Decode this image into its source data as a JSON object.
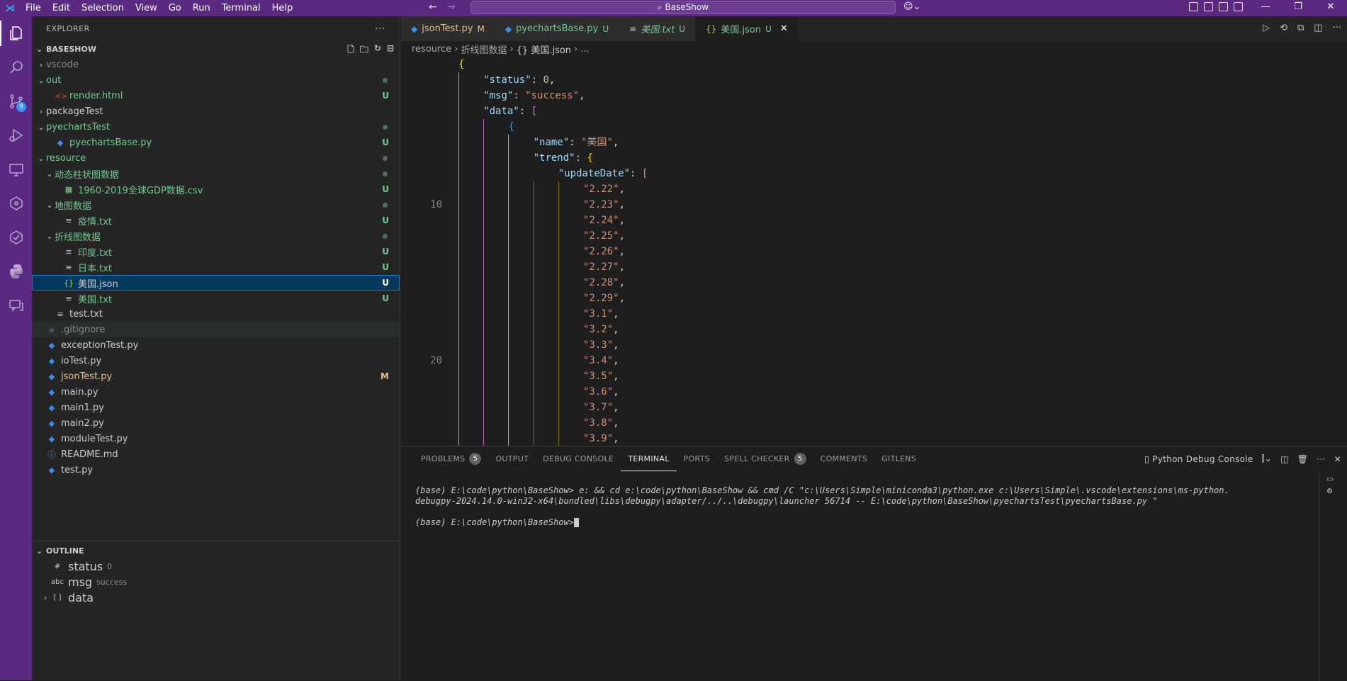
{
  "titlebar": {
    "menu": [
      "File",
      "Edit",
      "Selection",
      "View",
      "Go",
      "Run",
      "Terminal",
      "Help"
    ],
    "search": "BaseShow"
  },
  "activity": {
    "scm_badge": "9"
  },
  "sidebar": {
    "header": "EXPLORER",
    "more": "···",
    "root": "BASESHOW",
    "tree": [
      {
        "label": "vscode",
        "depth": 0,
        "chev": "›",
        "icon": "",
        "color": "gray",
        "status": "",
        "dot": false
      },
      {
        "label": "out",
        "depth": 0,
        "chev": "⌄",
        "icon": "",
        "color": "green",
        "status": "",
        "dot": true
      },
      {
        "label": "render.html",
        "depth": 1,
        "chev": "",
        "icon": "<>",
        "iconColor": "#e44d26",
        "color": "green",
        "status": "U",
        "dot": false
      },
      {
        "label": "packageTest",
        "depth": 0,
        "chev": "›",
        "icon": "",
        "color": "white",
        "status": "",
        "dot": false
      },
      {
        "label": "pyechartsTest",
        "depth": 0,
        "chev": "⌄",
        "icon": "",
        "color": "green",
        "status": "",
        "dot": true
      },
      {
        "label": "pyechartsBase.py",
        "depth": 1,
        "chev": "",
        "icon": "◆",
        "iconColor": "#3b8eea",
        "color": "green",
        "status": "U",
        "dot": false
      },
      {
        "label": "resource",
        "depth": 0,
        "chev": "⌄",
        "icon": "",
        "color": "green",
        "status": "",
        "dot": true
      },
      {
        "label": "动态柱状图数据",
        "depth": 1,
        "chev": "⌄",
        "icon": "",
        "color": "green",
        "status": "",
        "dot": true
      },
      {
        "label": "1960-2019全球GDP数据.csv",
        "depth": 2,
        "chev": "",
        "icon": "▦",
        "iconColor": "#89d185",
        "color": "green",
        "status": "U",
        "dot": false
      },
      {
        "label": "地图数据",
        "depth": 1,
        "chev": "⌄",
        "icon": "",
        "color": "green",
        "status": "",
        "dot": true
      },
      {
        "label": "疫情.txt",
        "depth": 2,
        "chev": "",
        "icon": "≡",
        "iconColor": "#c5c5c5",
        "color": "green",
        "status": "U",
        "dot": false
      },
      {
        "label": "折线图数据",
        "depth": 1,
        "chev": "⌄",
        "icon": "",
        "color": "green",
        "status": "",
        "dot": true
      },
      {
        "label": "印度.txt",
        "depth": 2,
        "chev": "",
        "icon": "≡",
        "iconColor": "#c5c5c5",
        "color": "green",
        "status": "U",
        "dot": false
      },
      {
        "label": "日本.txt",
        "depth": 2,
        "chev": "",
        "icon": "≡",
        "iconColor": "#c5c5c5",
        "color": "green",
        "status": "U",
        "dot": false
      },
      {
        "label": "美国.json",
        "depth": 2,
        "chev": "",
        "icon": "{}",
        "iconColor": "#cbcb41",
        "color": "white",
        "status": "U",
        "dot": false,
        "selected": true
      },
      {
        "label": "美国.txt",
        "depth": 2,
        "chev": "",
        "icon": "≡",
        "iconColor": "#c5c5c5",
        "color": "green",
        "status": "U",
        "dot": false
      },
      {
        "label": "test.txt",
        "depth": 1,
        "chev": "",
        "icon": "≡",
        "iconColor": "#c5c5c5",
        "color": "white",
        "status": "",
        "dot": false
      },
      {
        "label": ".gitignore",
        "depth": 0,
        "chev": "",
        "icon": "◆",
        "iconColor": "#41535b",
        "color": "gray",
        "status": "",
        "dot": false,
        "hover": true
      },
      {
        "label": "exceptionTest.py",
        "depth": 0,
        "chev": "",
        "icon": "◆",
        "iconColor": "#3b8eea",
        "color": "white",
        "status": "",
        "dot": false
      },
      {
        "label": "ioTest.py",
        "depth": 0,
        "chev": "",
        "icon": "◆",
        "iconColor": "#3b8eea",
        "color": "white",
        "status": "",
        "dot": false
      },
      {
        "label": "jsonTest.py",
        "depth": 0,
        "chev": "",
        "icon": "◆",
        "iconColor": "#3b8eea",
        "color": "yellow",
        "status": "M",
        "dot": false
      },
      {
        "label": "main.py",
        "depth": 0,
        "chev": "",
        "icon": "◆",
        "iconColor": "#3b8eea",
        "color": "white",
        "status": "",
        "dot": false
      },
      {
        "label": "main1.py",
        "depth": 0,
        "chev": "",
        "icon": "◆",
        "iconColor": "#3b8eea",
        "color": "white",
        "status": "",
        "dot": false
      },
      {
        "label": "main2.py",
        "depth": 0,
        "chev": "",
        "icon": "◆",
        "iconColor": "#3b8eea",
        "color": "white",
        "status": "",
        "dot": false
      },
      {
        "label": "moduleTest.py",
        "depth": 0,
        "chev": "",
        "icon": "◆",
        "iconColor": "#3b8eea",
        "color": "white",
        "status": "",
        "dot": false
      },
      {
        "label": "README.md",
        "depth": 0,
        "chev": "",
        "icon": "ⓘ",
        "iconColor": "#519aba",
        "color": "white",
        "status": "",
        "dot": false
      },
      {
        "label": "test.py",
        "depth": 0,
        "chev": "",
        "icon": "◆",
        "iconColor": "#3b8eea",
        "color": "white",
        "status": "",
        "dot": false
      }
    ],
    "outline": {
      "title": "OUTLINE",
      "items": [
        {
          "icon": "#",
          "label": "status",
          "detail": "0",
          "chev": ""
        },
        {
          "icon": "abc",
          "label": "msg",
          "detail": "success",
          "chev": ""
        },
        {
          "icon": "[ ]",
          "label": "data",
          "detail": "",
          "chev": "›"
        }
      ]
    }
  },
  "editor": {
    "tabs": [
      {
        "label": "jsonTest.py",
        "status": "M",
        "icon": "◆",
        "iconColor": "#3b8eea",
        "labelColor": "#e2c08d",
        "italic": false,
        "active": false
      },
      {
        "label": "pyechartsBase.py",
        "status": "U",
        "icon": "◆",
        "iconColor": "#3b8eea",
        "labelColor": "#73c991",
        "italic": false,
        "active": false
      },
      {
        "label": "美国.txt",
        "status": "U",
        "icon": "≡",
        "iconColor": "#c5c5c5",
        "labelColor": "#73c991",
        "italic": true,
        "active": false
      },
      {
        "label": "美国.json",
        "status": "U",
        "icon": "{}",
        "iconColor": "#cbcb41",
        "labelColor": "#73c991",
        "italic": false,
        "active": true
      }
    ],
    "close": "✕",
    "breadcrumb": [
      "resource",
      "折线图数据",
      "{} 美国.json",
      "..."
    ],
    "line_numbers": {
      "10": "10",
      "20": "20"
    },
    "code": [
      {
        "num": "",
        "indent": 0,
        "parts": [
          [
            "b1",
            "{"
          ]
        ]
      },
      {
        "num": "",
        "indent": 1,
        "parts": [
          [
            "k",
            "\"status\""
          ],
          [
            "p",
            ": "
          ],
          [
            "n",
            "0"
          ],
          [
            "p",
            ","
          ]
        ]
      },
      {
        "num": "",
        "indent": 1,
        "parts": [
          [
            "k",
            "\"msg\""
          ],
          [
            "p",
            ": "
          ],
          [
            "s",
            "\"success\""
          ],
          [
            "p",
            ","
          ]
        ]
      },
      {
        "num": "",
        "indent": 1,
        "parts": [
          [
            "k",
            "\"data\""
          ],
          [
            "p",
            ": "
          ],
          [
            "b2",
            "["
          ]
        ]
      },
      {
        "num": "",
        "indent": 2,
        "parts": [
          [
            "b3",
            "{"
          ]
        ]
      },
      {
        "num": "",
        "indent": 3,
        "parts": [
          [
            "k",
            "\"name\""
          ],
          [
            "p",
            ": "
          ],
          [
            "s",
            "\"美国\""
          ],
          [
            "p",
            ","
          ]
        ]
      },
      {
        "num": "",
        "indent": 3,
        "parts": [
          [
            "k",
            "\"trend\""
          ],
          [
            "p",
            ": "
          ],
          [
            "b1",
            "{"
          ]
        ]
      },
      {
        "num": "",
        "indent": 4,
        "parts": [
          [
            "k",
            "\"updateDate\""
          ],
          [
            "p",
            ": "
          ],
          [
            "b2",
            "["
          ]
        ]
      },
      {
        "num": "",
        "indent": 5,
        "parts": [
          [
            "s",
            "\"2.22\""
          ],
          [
            "p",
            ","
          ]
        ]
      },
      {
        "num": "10",
        "indent": 5,
        "parts": [
          [
            "s",
            "\"2.23\""
          ],
          [
            "p",
            ","
          ]
        ]
      },
      {
        "num": "",
        "indent": 5,
        "parts": [
          [
            "s",
            "\"2.24\""
          ],
          [
            "p",
            ","
          ]
        ]
      },
      {
        "num": "",
        "indent": 5,
        "parts": [
          [
            "s",
            "\"2.25\""
          ],
          [
            "p",
            ","
          ]
        ]
      },
      {
        "num": "",
        "indent": 5,
        "parts": [
          [
            "s",
            "\"2.26\""
          ],
          [
            "p",
            ","
          ]
        ]
      },
      {
        "num": "",
        "indent": 5,
        "parts": [
          [
            "s",
            "\"2.27\""
          ],
          [
            "p",
            ","
          ]
        ]
      },
      {
        "num": "",
        "indent": 5,
        "parts": [
          [
            "s",
            "\"2.28\""
          ],
          [
            "p",
            ","
          ]
        ]
      },
      {
        "num": "",
        "indent": 5,
        "parts": [
          [
            "s",
            "\"2.29\""
          ],
          [
            "p",
            ","
          ]
        ]
      },
      {
        "num": "",
        "indent": 5,
        "parts": [
          [
            "s",
            "\"3.1\""
          ],
          [
            "p",
            ","
          ]
        ]
      },
      {
        "num": "",
        "indent": 5,
        "parts": [
          [
            "s",
            "\"3.2\""
          ],
          [
            "p",
            ","
          ]
        ]
      },
      {
        "num": "",
        "indent": 5,
        "parts": [
          [
            "s",
            "\"3.3\""
          ],
          [
            "p",
            ","
          ]
        ]
      },
      {
        "num": "20",
        "indent": 5,
        "parts": [
          [
            "s",
            "\"3.4\""
          ],
          [
            "p",
            ","
          ]
        ]
      },
      {
        "num": "",
        "indent": 5,
        "parts": [
          [
            "s",
            "\"3.5\""
          ],
          [
            "p",
            ","
          ]
        ]
      },
      {
        "num": "",
        "indent": 5,
        "parts": [
          [
            "s",
            "\"3.6\""
          ],
          [
            "p",
            ","
          ]
        ]
      },
      {
        "num": "",
        "indent": 5,
        "parts": [
          [
            "s",
            "\"3.7\""
          ],
          [
            "p",
            ","
          ]
        ]
      },
      {
        "num": "",
        "indent": 5,
        "parts": [
          [
            "s",
            "\"3.8\""
          ],
          [
            "p",
            ","
          ]
        ]
      },
      {
        "num": "",
        "indent": 5,
        "parts": [
          [
            "s",
            "\"3.9\""
          ],
          [
            "p",
            ","
          ]
        ]
      }
    ]
  },
  "panel": {
    "tabs": [
      {
        "label": "PROBLEMS",
        "badge": "5",
        "active": false
      },
      {
        "label": "OUTPUT",
        "badge": "",
        "active": false
      },
      {
        "label": "DEBUG CONSOLE",
        "badge": "",
        "active": false
      },
      {
        "label": "TERMINAL",
        "badge": "",
        "active": true
      },
      {
        "label": "PORTS",
        "badge": "",
        "active": false
      },
      {
        "label": "SPELL CHECKER",
        "badge": "5",
        "active": false
      },
      {
        "label": "COMMENTS",
        "badge": "",
        "active": false
      },
      {
        "label": "GITLENS",
        "badge": "",
        "active": false
      }
    ],
    "terminal_name": "Python Debug Console",
    "terminal_lines": [
      "(base) E:\\code\\python\\BaseShow> e: && cd e:\\code\\python\\BaseShow && cmd /C \"c:\\Users\\Simple\\miniconda3\\python.exe c:\\Users\\Simple\\.vscode\\extensions\\ms-python.",
      "debugpy-2024.14.0-win32-x64\\bundled\\libs\\debugpy\\adapter/../..\\debugpy\\launcher 56714 -- E:\\code\\python\\BaseShow\\pyechartsTest\\pyechartsBase.py \"",
      "",
      "(base) E:\\code\\python\\BaseShow>"
    ]
  }
}
